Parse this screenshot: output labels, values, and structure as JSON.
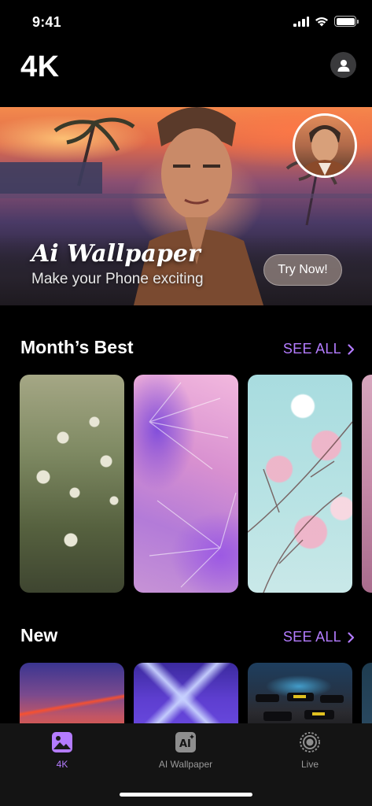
{
  "status": {
    "time": "9:41"
  },
  "header": {
    "title": "4K"
  },
  "banner": {
    "headline": "Ai Wallpaper",
    "subline": "Make your Phone exciting",
    "cta": "Try Now!"
  },
  "sections": {
    "months_best": {
      "title": "Month’s Best",
      "see_all": "SEE ALL"
    },
    "new": {
      "title": "New",
      "see_all": "SEE ALL"
    }
  },
  "tabs": [
    {
      "label": "4K",
      "icon": "image-icon",
      "active": true
    },
    {
      "label": "AI Wallpaper",
      "icon": "ai-icon",
      "active": false
    },
    {
      "label": "Live",
      "icon": "live-icon",
      "active": false
    }
  ],
  "colors": {
    "accent": "#b47cff",
    "background": "#000000",
    "tabbar": "#141414"
  }
}
